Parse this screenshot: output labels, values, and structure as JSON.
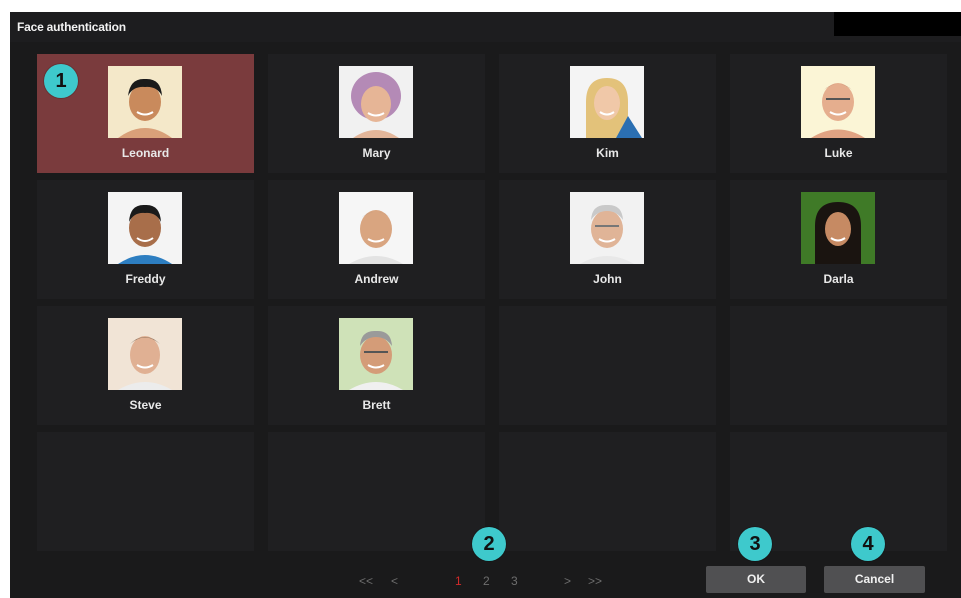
{
  "window": {
    "title": "Face authentication"
  },
  "users": [
    {
      "name": "Leonard",
      "selected": true
    },
    {
      "name": "Mary"
    },
    {
      "name": "Kim"
    },
    {
      "name": "Luke"
    },
    {
      "name": "Freddy"
    },
    {
      "name": "Andrew"
    },
    {
      "name": "John"
    },
    {
      "name": "Darla"
    },
    {
      "name": "Steve"
    },
    {
      "name": "Brett"
    }
  ],
  "pagination": {
    "first": "<<",
    "prev": "<",
    "pages": [
      "1",
      "2",
      "3"
    ],
    "current_page": "1",
    "next": ">",
    "last": ">>"
  },
  "buttons": {
    "ok": "OK",
    "cancel": "Cancel"
  },
  "callouts": [
    "1",
    "2",
    "3",
    "4"
  ],
  "colors": {
    "background": "#1a1a1b",
    "tile": "#1f1f21",
    "selected_tile": "#7a3b3d",
    "callout": "#3ec9cc",
    "active_page": "#d22a2a",
    "button": "#505052"
  }
}
